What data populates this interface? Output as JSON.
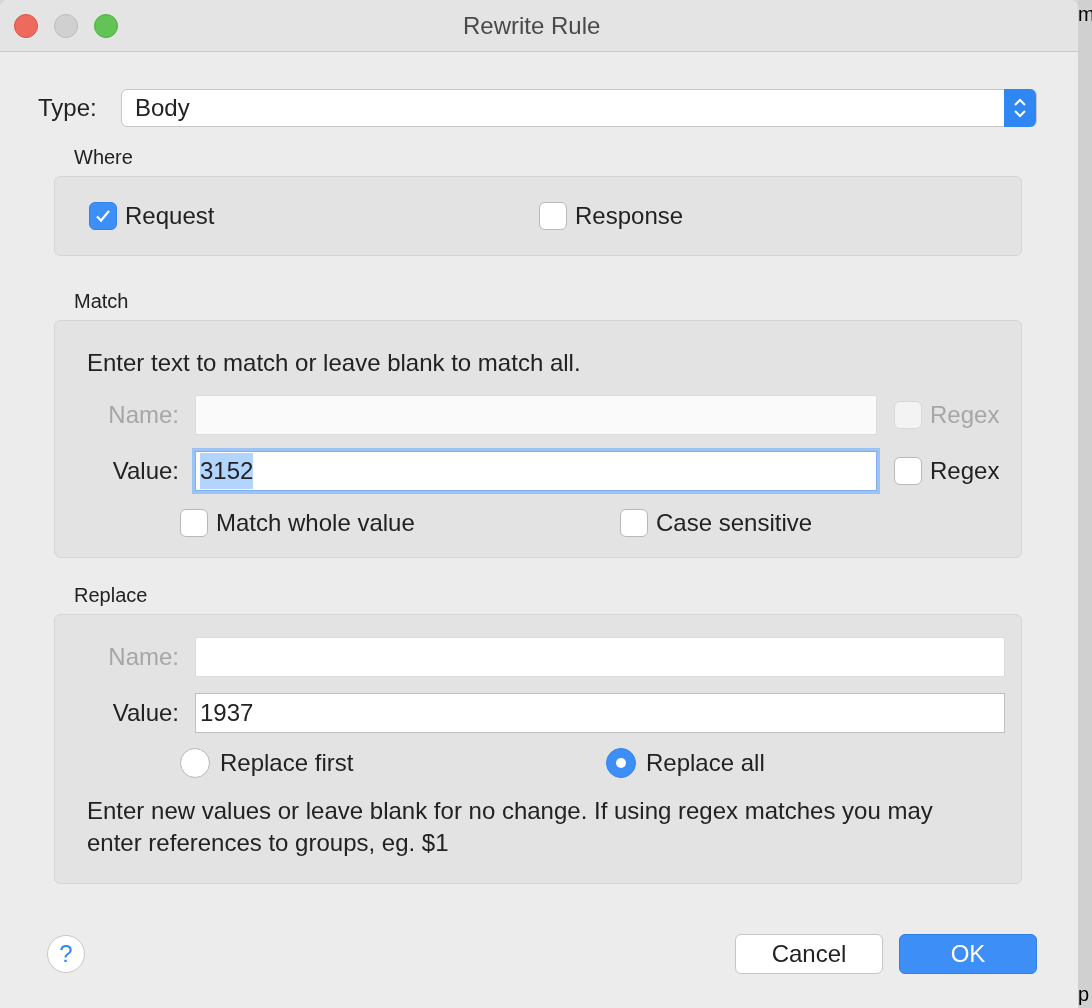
{
  "window": {
    "title": "Rewrite Rule"
  },
  "type_field": {
    "label": "Type:",
    "value": "Body"
  },
  "where": {
    "title": "Where",
    "options": [
      {
        "label": "Request",
        "checked": true
      },
      {
        "label": "Response",
        "checked": false
      }
    ]
  },
  "match": {
    "title": "Match",
    "hint": "Enter text to match or leave blank to match all.",
    "fields": [
      {
        "label": "Name:",
        "disabled": true,
        "focused": false,
        "regex": {
          "label": "Regex",
          "checked": false,
          "disabled": true
        }
      },
      {
        "label": "Value:",
        "value": "3152",
        "disabled": false,
        "focused": true,
        "regex": {
          "label": "Regex",
          "checked": false,
          "disabled": false
        }
      }
    ],
    "options": [
      {
        "label": "Match whole value",
        "checked": false
      },
      {
        "label": "Case sensitive",
        "checked": false
      }
    ]
  },
  "replace": {
    "title": "Replace",
    "fields": [
      {
        "label": "Name:",
        "disabled": true
      },
      {
        "label": "Value:",
        "value": "1937",
        "disabled": false
      }
    ],
    "modes": [
      {
        "label": "Replace first",
        "selected": false
      },
      {
        "label": "Replace all",
        "selected": true
      }
    ],
    "note": "Enter new values or leave blank for no change. If using regex matches you may enter references to groups, eg. $1"
  },
  "help": {
    "label": "?"
  },
  "buttons": [
    {
      "label": "Cancel",
      "kind": "normal"
    },
    {
      "label": "OK",
      "kind": "default"
    }
  ],
  "background": {
    "texts": [
      "m",
      "p"
    ]
  }
}
